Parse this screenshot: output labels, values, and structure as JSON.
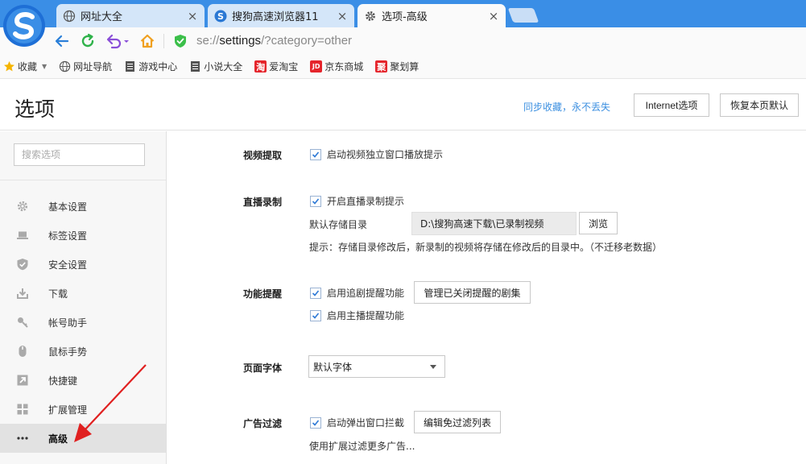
{
  "browser": {
    "tabs": [
      {
        "title": "网址大全",
        "icon": "globe-icon",
        "active": false
      },
      {
        "title": "搜狗高速浏览器11",
        "icon": "sogou-logo-icon",
        "active": false
      },
      {
        "title": "选项-高级",
        "icon": "gear-icon",
        "active": true
      }
    ],
    "address": {
      "scheme": "se://",
      "path": "settings",
      "query": "/?category=other"
    }
  },
  "bookmarks": [
    {
      "label": "收藏",
      "icon": "star-icon"
    },
    {
      "label": "网址导航",
      "icon": "globe-icon"
    },
    {
      "label": "游戏中心",
      "icon": "page-icon"
    },
    {
      "label": "小说大全",
      "icon": "page-icon"
    },
    {
      "label": "爱淘宝",
      "icon": "taobao-icon",
      "icon_text": "淘"
    },
    {
      "label": "京东商城",
      "icon": "jd-icon",
      "icon_text": "JD"
    },
    {
      "label": "聚划算",
      "icon": "juhuasuan-icon",
      "icon_text": "聚"
    }
  ],
  "options": {
    "title": "选项",
    "sync_link": "同步收藏，永不丢失",
    "internet_button": "Internet选项",
    "restore_button": "恢复本页默认",
    "search_placeholder": "搜索选项"
  },
  "sidebar": {
    "items": [
      {
        "label": "基本设置",
        "icon": "gear-icon",
        "active": false
      },
      {
        "label": "标签设置",
        "icon": "laptop-icon",
        "active": false
      },
      {
        "label": "安全设置",
        "icon": "shield-icon",
        "active": false
      },
      {
        "label": "下载",
        "icon": "download-icon",
        "active": false
      },
      {
        "label": "帐号助手",
        "icon": "key-icon",
        "active": false
      },
      {
        "label": "鼠标手势",
        "icon": "mouse-icon",
        "active": false
      },
      {
        "label": "快捷键",
        "icon": "shortcut-arrow-icon",
        "active": false
      },
      {
        "label": "扩展管理",
        "icon": "extensions-grid-icon",
        "active": false
      },
      {
        "label": "高级",
        "icon": "more-dots-icon",
        "active": true
      }
    ]
  },
  "sections": {
    "video_extract": {
      "label": "视频提取",
      "popup_tip": {
        "label": "启动视频独立窗口播放提示",
        "checked": true
      }
    },
    "live_record": {
      "label": "直播录制",
      "record_tip": {
        "label": "开启直播录制提示",
        "checked": true
      },
      "save_dir_label": "默认存储目录",
      "save_dir_value": "D:\\搜狗高速下载\\已录制视频",
      "browse_button": "浏览",
      "hint": "提示：存储目录修改后，新录制的视频将存储在修改后的目录中。（不迁移老数据）"
    },
    "reminders": {
      "label": "功能提醒",
      "drama_tip": {
        "label": "启用追剧提醒功能",
        "checked": true
      },
      "manage_button": "管理已关闭提醒的剧集",
      "anchor_tip": {
        "label": "启用主播提醒功能",
        "checked": true
      }
    },
    "font": {
      "label": "页面字体",
      "selected": "默认字体"
    },
    "ad_filter": {
      "label": "广告过滤",
      "popup_block": {
        "label": "启动弹出窗口拦截",
        "checked": true
      },
      "edit_whitelist_button": "编辑免过滤列表",
      "more_text": "使用扩展过滤更多广告..."
    }
  },
  "colors": {
    "tabbar": "#3a8ee6",
    "link": "#3b8fe0",
    "check": "#2f7ad6",
    "annotation_arrow": "#e02020"
  }
}
